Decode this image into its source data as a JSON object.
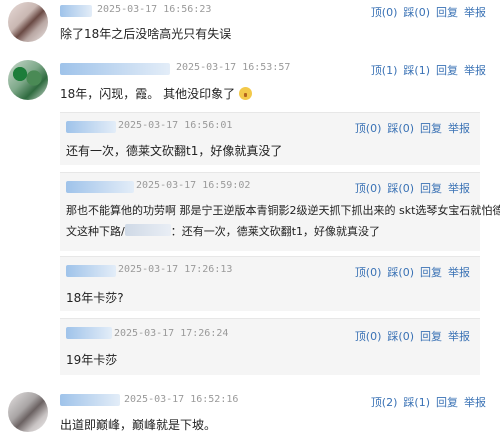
{
  "comments": [
    {
      "timestamp": "2025-03-17 16:56:23",
      "text": "除了18年之后没啥高光只有失误",
      "actions": {
        "up": "顶(0)",
        "down": "踩(0)",
        "reply": "回复",
        "report": "举报"
      }
    },
    {
      "timestamp": "2025-03-17 16:53:57",
      "text": "18年，闪现，霞。 其他没印象了",
      "actions": {
        "up": "顶(1)",
        "down": "踩(1)",
        "reply": "回复",
        "report": "举报"
      },
      "replies": [
        {
          "timestamp": "2025-03-17 16:56:01",
          "text": "还有一次，德莱文砍翻t1，好像就真没了",
          "actions": {
            "up": "顶(0)",
            "down": "踩(0)",
            "reply": "回复",
            "report": "举报"
          }
        },
        {
          "timestamp": "2025-03-17 16:59:02",
          "text_line1": "那也不能算他的功劳啊 那是宁王逆版本青铜影2级逆天抓下抓出来的 skt选琴女宝石就怕德莱",
          "text_line2_before": "文这种下路/",
          "text_line2_after": "：还有一次，德莱文砍翻t1，好像就真没了",
          "actions": {
            "up": "顶(0)",
            "down": "踩(0)",
            "reply": "回复",
            "report": "举报"
          }
        },
        {
          "timestamp": "2025-03-17 17:26:13",
          "text": "18年卡莎?",
          "actions": {
            "up": "顶(0)",
            "down": "踩(0)",
            "reply": "回复",
            "report": "举报"
          }
        },
        {
          "timestamp": "2025-03-17 17:26:24",
          "text": "19年卡莎",
          "actions": {
            "up": "顶(0)",
            "down": "踩(0)",
            "reply": "回复",
            "report": "举报"
          }
        }
      ]
    },
    {
      "timestamp": "2025-03-17 16:52:16",
      "text": "出道即巅峰，巅峰就是下坡。",
      "actions": {
        "up": "顶(2)",
        "down": "踩(1)",
        "reply": "回复",
        "report": "举报"
      }
    }
  ]
}
